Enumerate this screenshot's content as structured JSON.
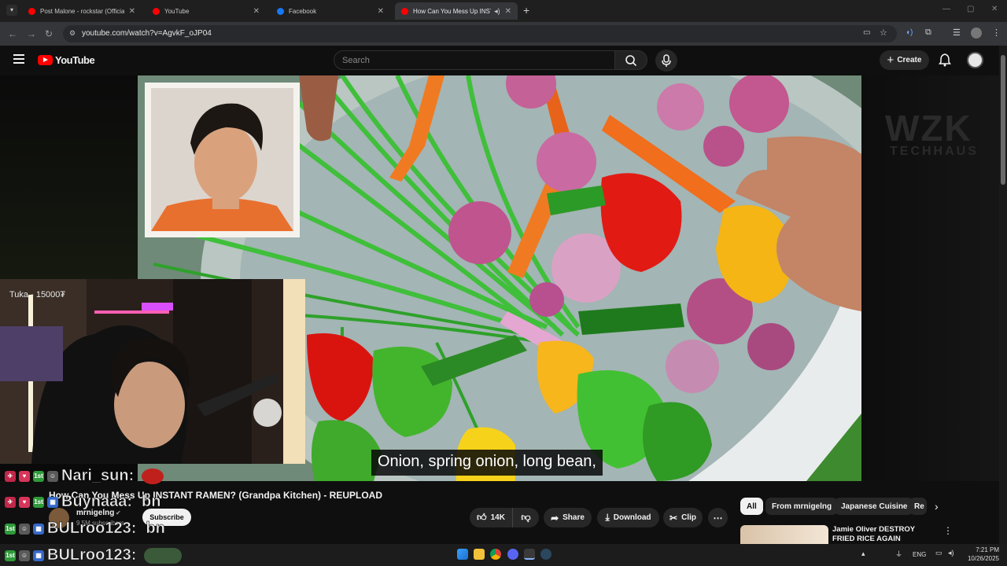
{
  "browser": {
    "tabs": [
      {
        "title": "Post Malone - rockstar (Official",
        "active": false
      },
      {
        "title": "YouTube",
        "active": false
      },
      {
        "title": "Facebook",
        "active": false
      },
      {
        "title": "How Can You Mess Up INST",
        "active": true
      }
    ],
    "url": "youtube.com/watch?v=AgvkF_oJP04"
  },
  "youtube": {
    "logo": "YouTube",
    "search_placeholder": "Search",
    "create_label": "Create"
  },
  "video": {
    "caption": "Onion, spring onion, long bean,",
    "cam_overlay": "Tuka - 15000₮",
    "side_watermark_1": "WZK",
    "side_watermark_2": "TECHHAUS"
  },
  "chat": [
    {
      "user": "Nari_sun:",
      "message": ""
    },
    {
      "user": "Buynaaa:",
      "message": "bn"
    },
    {
      "user": "BULroo123:",
      "message": "bn"
    },
    {
      "user": "BULroo123:",
      "message": ""
    }
  ],
  "watch": {
    "title": "How Can You Mess Up INSTANT RAMEN? (Grandpa Kitchen) - REUPLOAD",
    "channel": "mrnigelng",
    "subscribers": "9.5M subscribers",
    "subscribe_label": "Subscribe",
    "like_count": "14K",
    "share_label": "Share",
    "download_label": "Download",
    "clip_label": "Clip"
  },
  "filter_chips": [
    "All",
    "From mrnigelng",
    "Japanese Cuisine",
    "Re"
  ],
  "recommended": {
    "title": "Jamie Oliver DESTROY FRIED RICE AGAIN"
  },
  "taskbar": {
    "language": "ENG",
    "time": "7:21 PM",
    "date": "10/26/2025"
  },
  "colors": {
    "youtube_red": "#ff0000",
    "background": "#0f0f0f",
    "chip_bg": "#272727"
  }
}
